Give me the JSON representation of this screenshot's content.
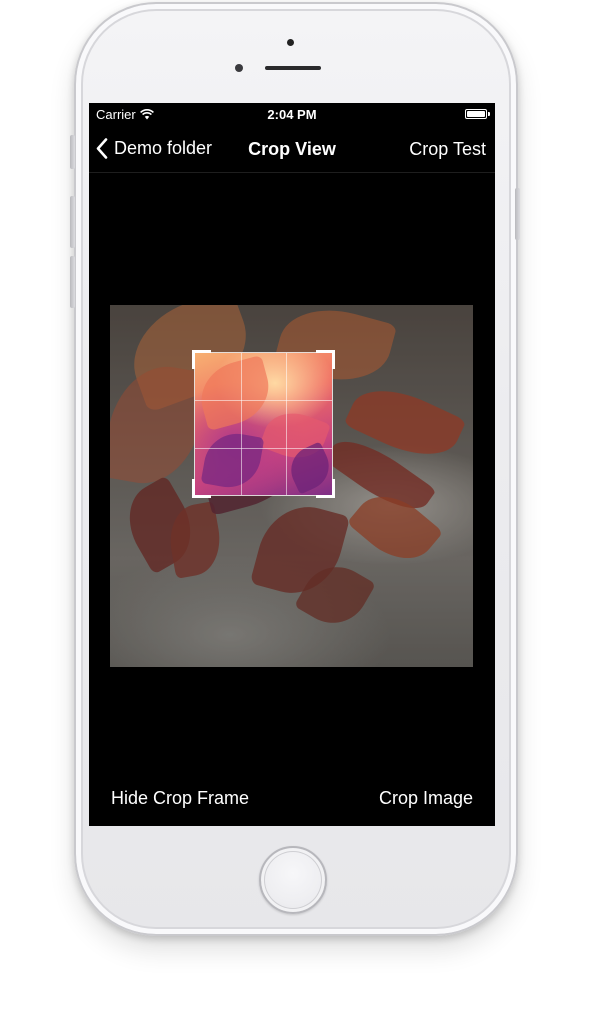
{
  "status_bar": {
    "carrier": "Carrier",
    "time": "2:04 PM",
    "wifi_icon": "wifi-icon",
    "battery_level": 1.0
  },
  "nav": {
    "back_label": "Demo folder",
    "back_icon": "chevron-left-icon",
    "title": "Crop View",
    "right_label": "Crop Test"
  },
  "toolbar": {
    "left_label": "Hide Crop Frame",
    "right_label": "Crop Image"
  },
  "crop": {
    "grid": "3x3"
  },
  "colors": {
    "screen_background": "#000000",
    "text": "#ffffff",
    "device_body": "#ececef"
  }
}
